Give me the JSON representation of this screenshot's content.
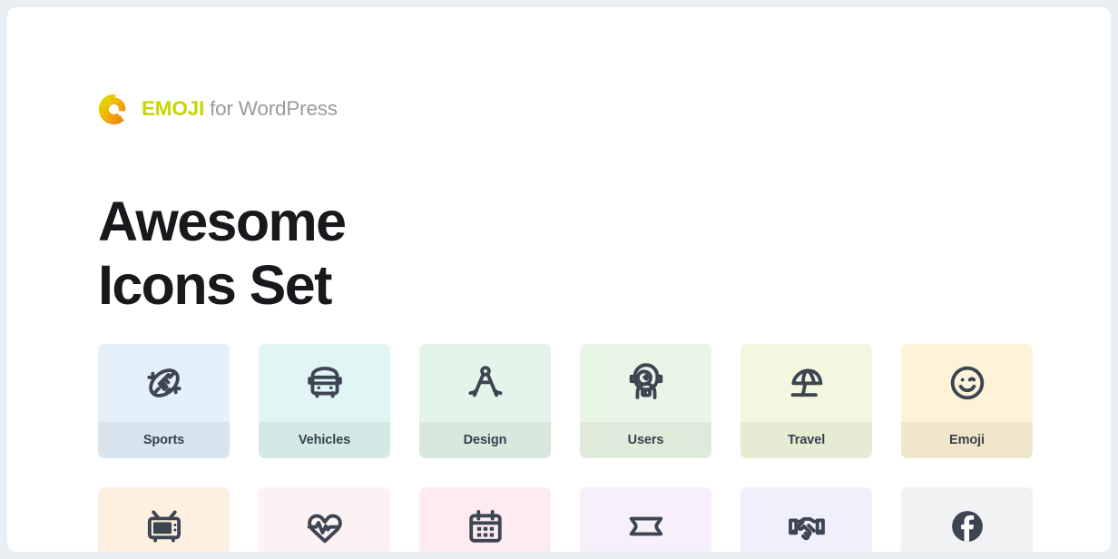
{
  "brand": {
    "logo_icon": "emoji-e-logo",
    "name_primary": "EMOJI",
    "name_secondary": " for WordPress",
    "primary_color": "#c6d600",
    "secondary_color": "#9b9b9b",
    "logo_gradient_from": "#d4e000",
    "logo_gradient_to": "#f08a0c"
  },
  "headline": {
    "line1": "Awesome",
    "line2": "Icons Set",
    "color": "#17191c"
  },
  "grid": {
    "icon_color": "#3d4552",
    "label_color": "#39414d",
    "rows": [
      {
        "name": "row-1",
        "has_labels": true,
        "cards": [
          {
            "label": "Sports",
            "icon": "football-icon",
            "art_bg": "#e4f0fa",
            "label_bg": "#d8e4ee"
          },
          {
            "label": "Vehicles",
            "icon": "bus-icon",
            "art_bg": "#e0f5f4",
            "label_bg": "#d4e8e6"
          },
          {
            "label": "Design",
            "icon": "compass-icon",
            "art_bg": "#e3f5ea",
            "label_bg": "#d8e8dd"
          },
          {
            "label": "Users",
            "icon": "astronaut-icon",
            "art_bg": "#e9f5e6",
            "label_bg": "#dfeadb"
          },
          {
            "label": "Travel",
            "icon": "beach-umbrella-icon",
            "art_bg": "#f3f7e0",
            "label_bg": "#e6ebd3"
          },
          {
            "label": "Emoji",
            "icon": "wink-smiley-icon",
            "art_bg": "#fcf3d8",
            "label_bg": "#efe6cb"
          }
        ]
      },
      {
        "name": "row-2",
        "has_labels": false,
        "cards": [
          {
            "label": "",
            "icon": "retro-tv-icon",
            "art_bg": "#fdf0e0",
            "label_bg": "#fdf0e0"
          },
          {
            "label": "",
            "icon": "heartbeat-icon",
            "art_bg": "#fdf2f3",
            "label_bg": "#fdf2f3"
          },
          {
            "label": "",
            "icon": "calendar-icon",
            "art_bg": "#fdebf1",
            "label_bg": "#fdebf1"
          },
          {
            "label": "",
            "icon": "ticket-icon",
            "art_bg": "#f7f0fb",
            "label_bg": "#f7f0fb"
          },
          {
            "label": "",
            "icon": "handshake-icon",
            "art_bg": "#f0effc",
            "label_bg": "#f0effc"
          },
          {
            "label": "",
            "icon": "facebook-icon",
            "art_bg": "#f1f2f3",
            "label_bg": "#f1f2f3"
          }
        ]
      }
    ]
  }
}
